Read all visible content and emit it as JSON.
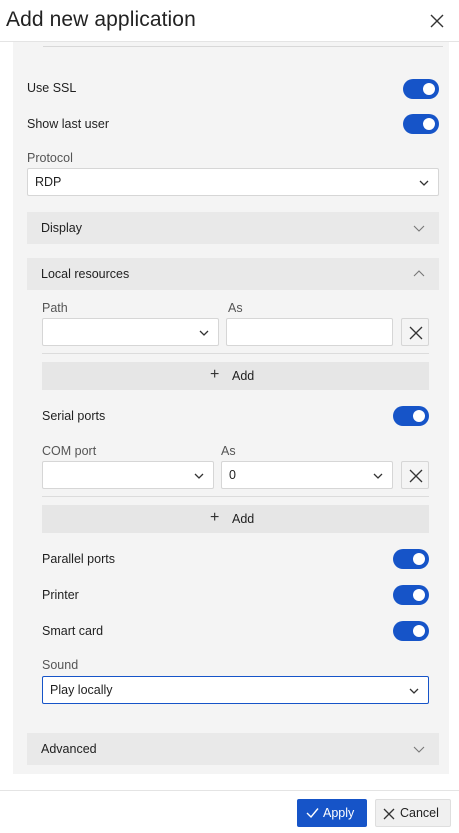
{
  "dialog": {
    "title": "Add new application",
    "close_icon": "close-icon"
  },
  "form": {
    "use_ssl": {
      "label": "Use SSL",
      "enabled": true
    },
    "show_last_user": {
      "label": "Show last user",
      "enabled": true
    },
    "protocol": {
      "label": "Protocol",
      "value": "RDP"
    }
  },
  "sections": {
    "display": {
      "title": "Display",
      "expanded": false
    },
    "local_resources": {
      "title": "Local resources",
      "expanded": true
    },
    "advanced": {
      "title": "Advanced",
      "expanded": false
    }
  },
  "local_resources": {
    "drive_mapping": {
      "path_label": "Path",
      "as_label": "As",
      "path_value": "",
      "as_value": "",
      "add_label": "Add"
    },
    "serial_ports": {
      "label": "Serial ports",
      "enabled": true
    },
    "com_mapping": {
      "com_label": "COM port",
      "as_label": "As",
      "com_value": "",
      "as_value": "0",
      "add_label": "Add"
    },
    "parallel_ports": {
      "label": "Parallel ports",
      "enabled": true
    },
    "printer": {
      "label": "Printer",
      "enabled": true
    },
    "smart_card": {
      "label": "Smart card",
      "enabled": true
    },
    "sound": {
      "label": "Sound",
      "value": "Play locally"
    }
  },
  "footer": {
    "apply_label": "Apply",
    "cancel_label": "Cancel"
  },
  "colors": {
    "accent": "#1654c8",
    "section_bg": "#e9e9e9",
    "panel_bg": "#f4f4f4"
  }
}
